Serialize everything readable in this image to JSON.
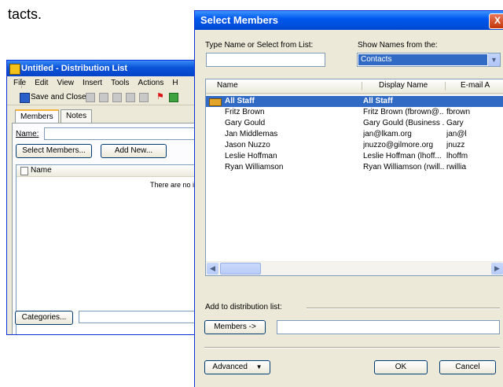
{
  "page_fragment_text": "tacts.",
  "distribution_window": {
    "title": "Untitled - Distribution List",
    "menu": [
      "File",
      "Edit",
      "View",
      "Insert",
      "Tools",
      "Actions",
      "H"
    ],
    "toolbar": {
      "save_label": "Save and Close"
    },
    "tabs": [
      "Members",
      "Notes"
    ],
    "name_label": "Name:",
    "select_members_label": "Select Members...",
    "add_new_label": "Add New...",
    "list_header_name": "Name",
    "empty_message": "There are no it",
    "categories_label": "Categories..."
  },
  "select_members_dialog": {
    "title": "Select Members",
    "close_glyph": "X",
    "type_name_label": "Type Name or Select from List:",
    "show_names_label": "Show Names from the:",
    "address_book": "Contacts",
    "columns": [
      "Name",
      "Display Name",
      "E-mail A"
    ],
    "rows": [
      {
        "name": "All Staff",
        "display": "All Staff",
        "email": "",
        "selected": true,
        "group": true
      },
      {
        "name": "Fritz Brown",
        "display": "Fritz Brown (fbrown@...",
        "email": "fbrown",
        "selected": false,
        "group": false
      },
      {
        "name": "Gary Gould",
        "display": "Gary Gould (Business ...",
        "email": "Gary",
        "selected": false,
        "group": false
      },
      {
        "name": "Jan Middlemas",
        "display": "jan@lkam.org",
        "email": "jan@l",
        "selected": false,
        "group": false
      },
      {
        "name": "Jason Nuzzo",
        "display": "jnuzzo@gilmore.org",
        "email": "jnuzz",
        "selected": false,
        "group": false
      },
      {
        "name": "Leslie Hoffman",
        "display": "Leslie Hoffman (lhoff...",
        "email": "lhoffm",
        "selected": false,
        "group": false
      },
      {
        "name": "Ryan Williamson",
        "display": "Ryan Williamson (rwill...",
        "email": "rwillia",
        "selected": false,
        "group": false
      }
    ],
    "add_to_label": "Add to distribution list:",
    "members_button": "Members ->",
    "advanced_button": "Advanced",
    "ok_button": "OK",
    "cancel_button": "Cancel"
  },
  "colors": {
    "titlebar": "#0058ee",
    "selection": "#316ac5",
    "dialog_bg": "#ece9d8"
  }
}
